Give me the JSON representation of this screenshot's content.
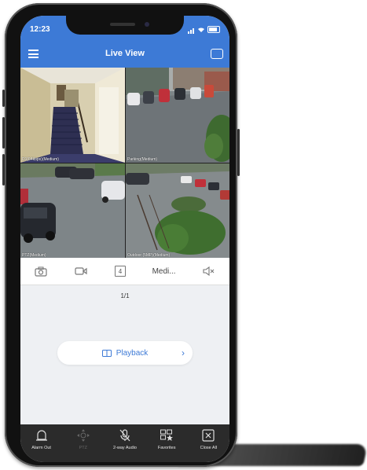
{
  "status": {
    "time": "12:23"
  },
  "nav": {
    "title": "Live View",
    "menu_icon": "menu-icon",
    "switch_icon": "screen-switch-icon"
  },
  "cameras": [
    {
      "label": "D1(64kbps)(Medium)"
    },
    {
      "label": "Parking(Medium)"
    },
    {
      "label": "PTZ(Medium)"
    },
    {
      "label": "Outdoor (5MP)(Medium)"
    }
  ],
  "controls": {
    "split_count": "4",
    "quality": "Medi..."
  },
  "pager": {
    "text": "1/1"
  },
  "playback": {
    "label": "Playback"
  },
  "toolbar": {
    "alarm_out": "Alarm Out",
    "ptz": "PTZ",
    "two_way_audio": "2-way Audio",
    "favorites": "Favorites",
    "close_all": "Close All"
  },
  "colors": {
    "accent": "#3d7ad6",
    "toolbar_bg": "#2b2b2b",
    "screen_bg": "#eef0f3"
  }
}
